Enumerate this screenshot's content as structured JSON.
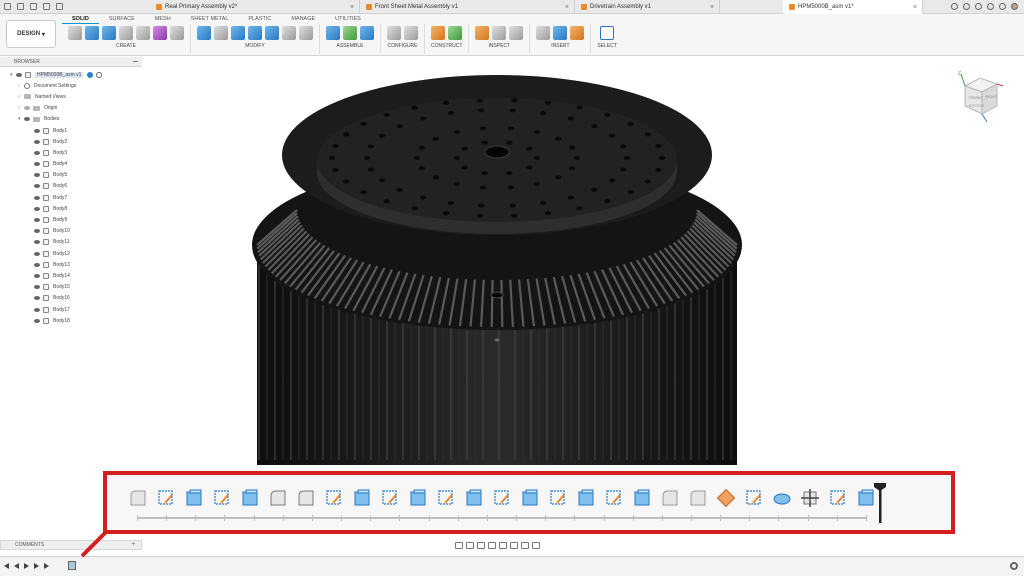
{
  "tabs": [
    {
      "label": "Real Primary Assembly v2*",
      "active": false
    },
    {
      "label": "Front Sheet Metal Assembly v1",
      "active": false
    },
    {
      "label": "Drivetrain Assembly v1",
      "active": false
    },
    {
      "label": "HPM5000B_asm v1*",
      "active": true
    }
  ],
  "ribbon": {
    "workspace_button": "DESIGN",
    "tabs": [
      "SOLID",
      "SURFACE",
      "MESH",
      "SHEET METAL",
      "PLASTIC",
      "MANAGE",
      "UTILITIES"
    ],
    "groups": [
      "CREATE",
      "MODIFY",
      "ASSEMBLE",
      "CONFIGURE",
      "CONSTRUCT",
      "INSPECT",
      "INSERT",
      "SELECT"
    ]
  },
  "browser": {
    "title": "BROWSER",
    "root": "HPM5000B_asm v1",
    "items": [
      "Document Settings",
      "Named Views",
      "Origin",
      "Bodies"
    ],
    "bodies": [
      "Body1",
      "Body2",
      "Body3",
      "Body4",
      "Body5",
      "Body6",
      "Body7",
      "Body8",
      "Body9",
      "Body10",
      "Body11",
      "Body12",
      "Body13",
      "Body14",
      "Body15",
      "Body16",
      "Body17",
      "Body18"
    ]
  },
  "comments": {
    "label": "COMMENTS"
  },
  "viewcube": {
    "faces": [
      "FRONT",
      "RIGHT",
      "BOTTOM"
    ],
    "axis": "Z"
  },
  "timeline": {
    "feature_icons": [
      "fillet",
      "sketch",
      "extrude",
      "sketch",
      "extrude",
      "chamfer",
      "chamfer",
      "sketch",
      "extrude",
      "sketch",
      "extrude",
      "sketch",
      "extrude",
      "sketch",
      "extrude",
      "sketch",
      "extrude",
      "sketch",
      "extrude",
      "fillet",
      "fillet",
      "appearance",
      "sketch",
      "revolve",
      "move-pattern",
      "sketch",
      "extrude"
    ]
  },
  "colors": {
    "accent": "#0696d7",
    "callout": "#d21f1f",
    "model": "#161616"
  }
}
